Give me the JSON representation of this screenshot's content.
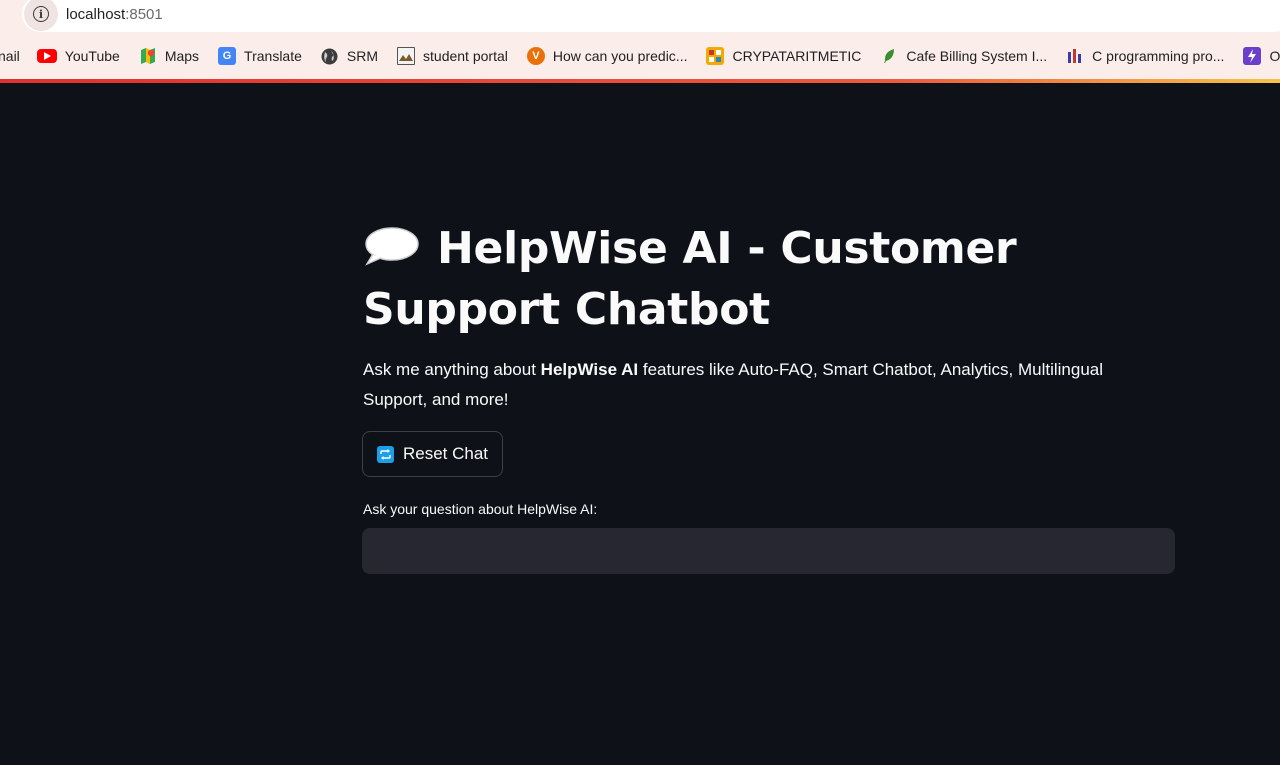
{
  "browser": {
    "url_host": "localhost",
    "url_port": ":8501",
    "bookmarks": [
      {
        "label": "nail",
        "icon": "gmail-icon"
      },
      {
        "label": "YouTube",
        "icon": "youtube-icon",
        "color": "#ff0000"
      },
      {
        "label": "Maps",
        "icon": "maps-icon"
      },
      {
        "label": "Translate",
        "icon": "translate-icon",
        "color": "#4285f4"
      },
      {
        "label": "SRM",
        "icon": "globe-icon"
      },
      {
        "label": "student portal",
        "icon": "image-icon"
      },
      {
        "label": "How can you predic...",
        "icon": "v-icon",
        "color": "#e8710a"
      },
      {
        "label": "CRYPATARITMETIC",
        "icon": "grid-icon",
        "color": "#f2a900"
      },
      {
        "label": "Cafe Billing System I...",
        "icon": "leaf-icon",
        "color": "#3b8e2d"
      },
      {
        "label": "C programming pro...",
        "icon": "bars-icon",
        "color": "#3c3ca8"
      },
      {
        "label": "Online C",
        "icon": "bolt-icon",
        "color": "#6a3fc9"
      }
    ]
  },
  "app": {
    "title_text": "HelpWise AI - Customer Support Chatbot",
    "title_icon": "speech-bubble-icon",
    "description": {
      "prefix": "Ask me anything about ",
      "bold": "HelpWise AI",
      "suffix": " features like Auto-FAQ, Smart Chatbot, Analytics, Multilingual Support, and more!"
    },
    "reset_button_label": "Reset Chat",
    "reset_button_icon": "repeat-icon",
    "input_label": "Ask your question about HelpWise AI:",
    "input_value": "",
    "colors": {
      "background": "#0e1117",
      "text": "#fafafa",
      "input_background": "#262730",
      "accent_icon": "#1a9fe8"
    }
  }
}
